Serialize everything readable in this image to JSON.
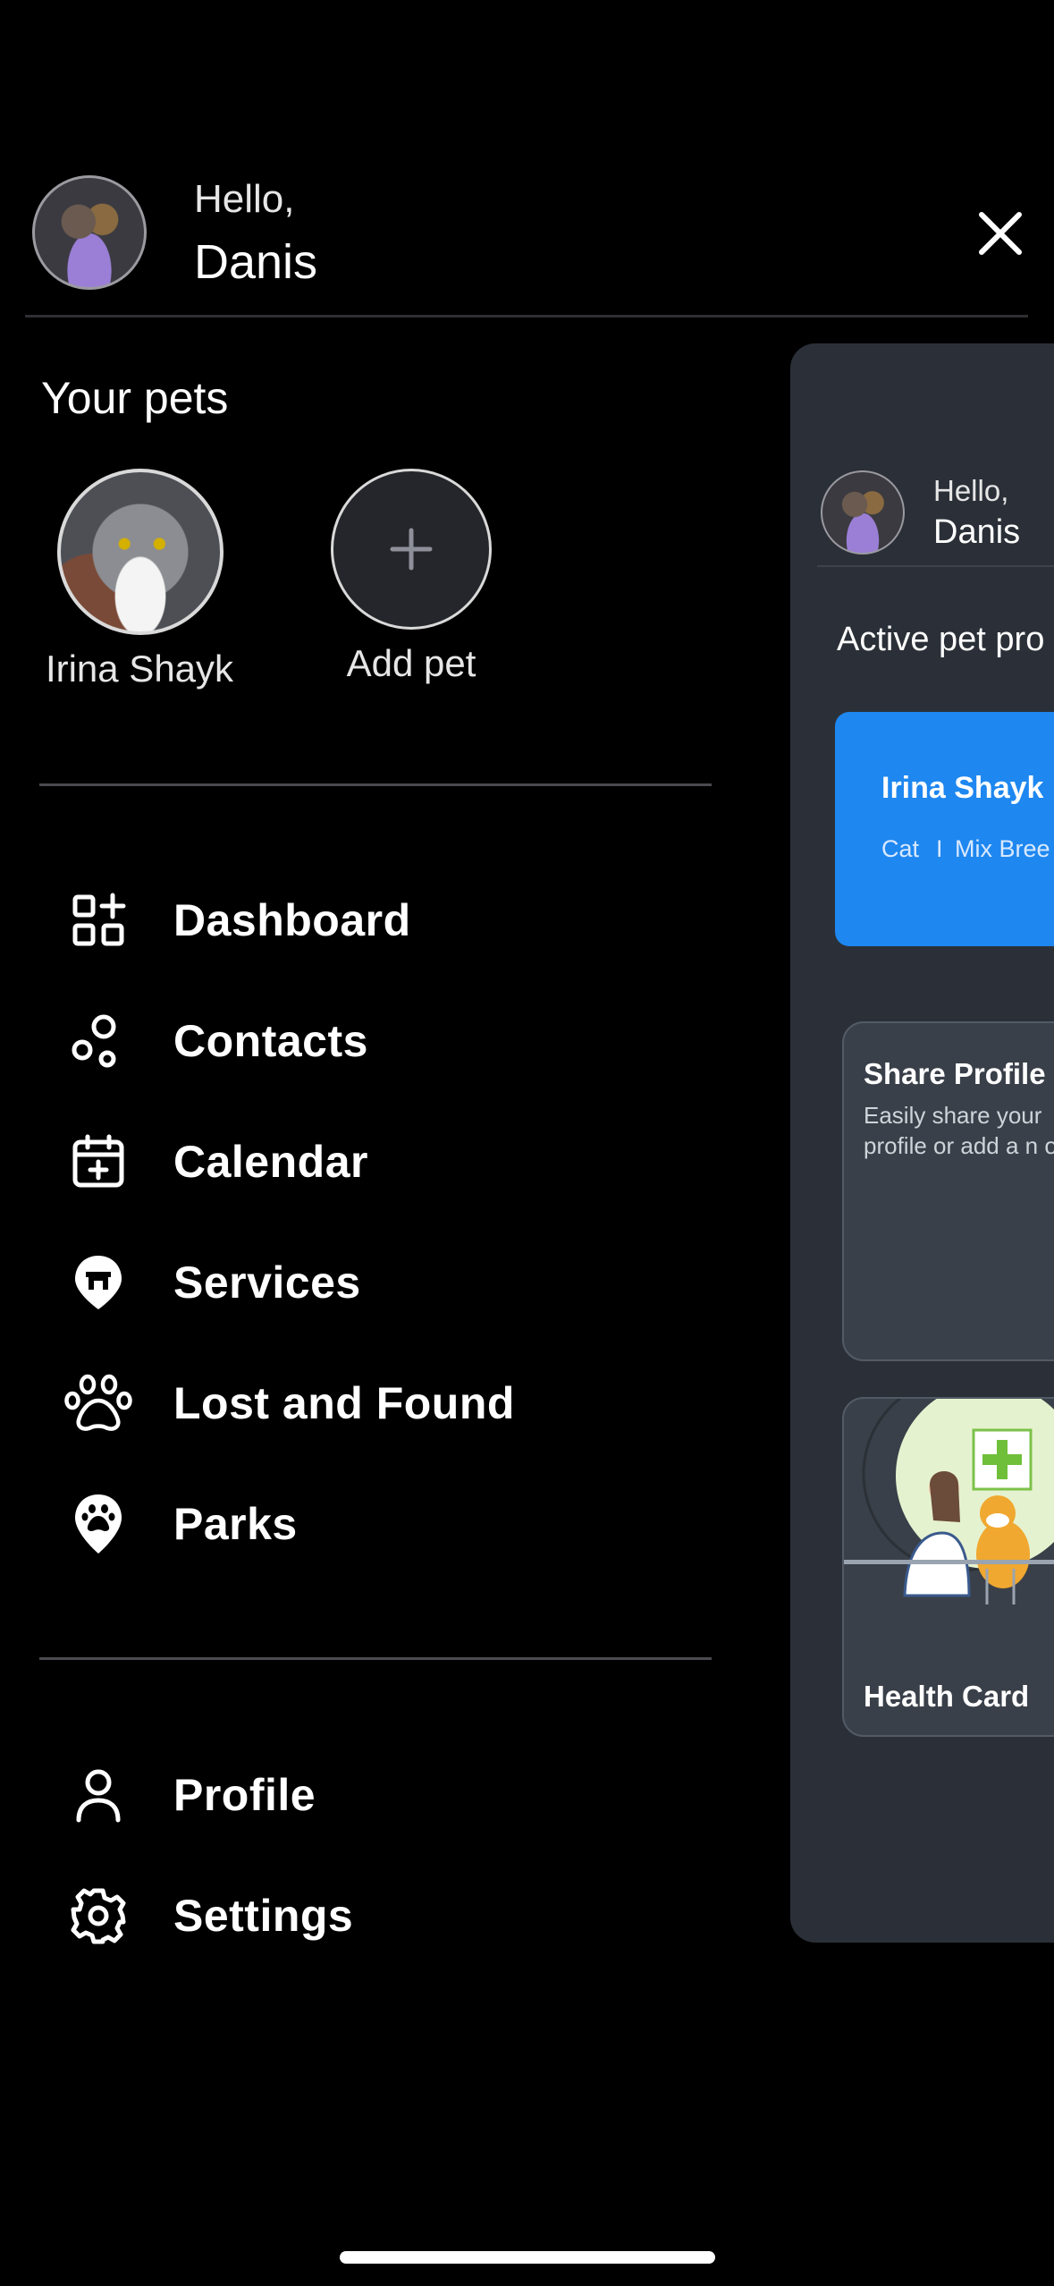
{
  "header": {
    "greeting": "Hello,",
    "user_name": "Danis"
  },
  "pets": {
    "section_title": "Your pets",
    "items": [
      {
        "name": "Irina Shayk"
      }
    ],
    "add_label": "Add pet"
  },
  "nav": {
    "items": [
      {
        "label": "Dashboard",
        "icon": "dashboard-grid-plus-icon"
      },
      {
        "label": "Contacts",
        "icon": "contacts-nodes-icon"
      },
      {
        "label": "Calendar",
        "icon": "calendar-add-icon"
      },
      {
        "label": "Services",
        "icon": "services-location-icon"
      },
      {
        "label": "Lost and Found",
        "icon": "paw-icon"
      },
      {
        "label": "Parks",
        "icon": "paw-location-icon"
      }
    ],
    "secondary": [
      {
        "label": "Profile",
        "icon": "person-icon"
      },
      {
        "label": "Settings",
        "icon": "gear-icon"
      }
    ]
  },
  "panel": {
    "greeting": "Hello,",
    "user_name": "Danis",
    "section_title": "Active pet pro",
    "pet_card": {
      "name": "Irina Shayk",
      "type": "Cat",
      "separator": "I",
      "breed": "Mix Bree"
    },
    "share_card": {
      "title": "Share Profile",
      "text": "Easily share your profile or add a n one"
    },
    "health_card": {
      "title": "Health Card"
    }
  },
  "colors": {
    "background": "#000000",
    "panel": "#2b3038",
    "accent": "#1e87f0",
    "card": "#3a4049"
  }
}
